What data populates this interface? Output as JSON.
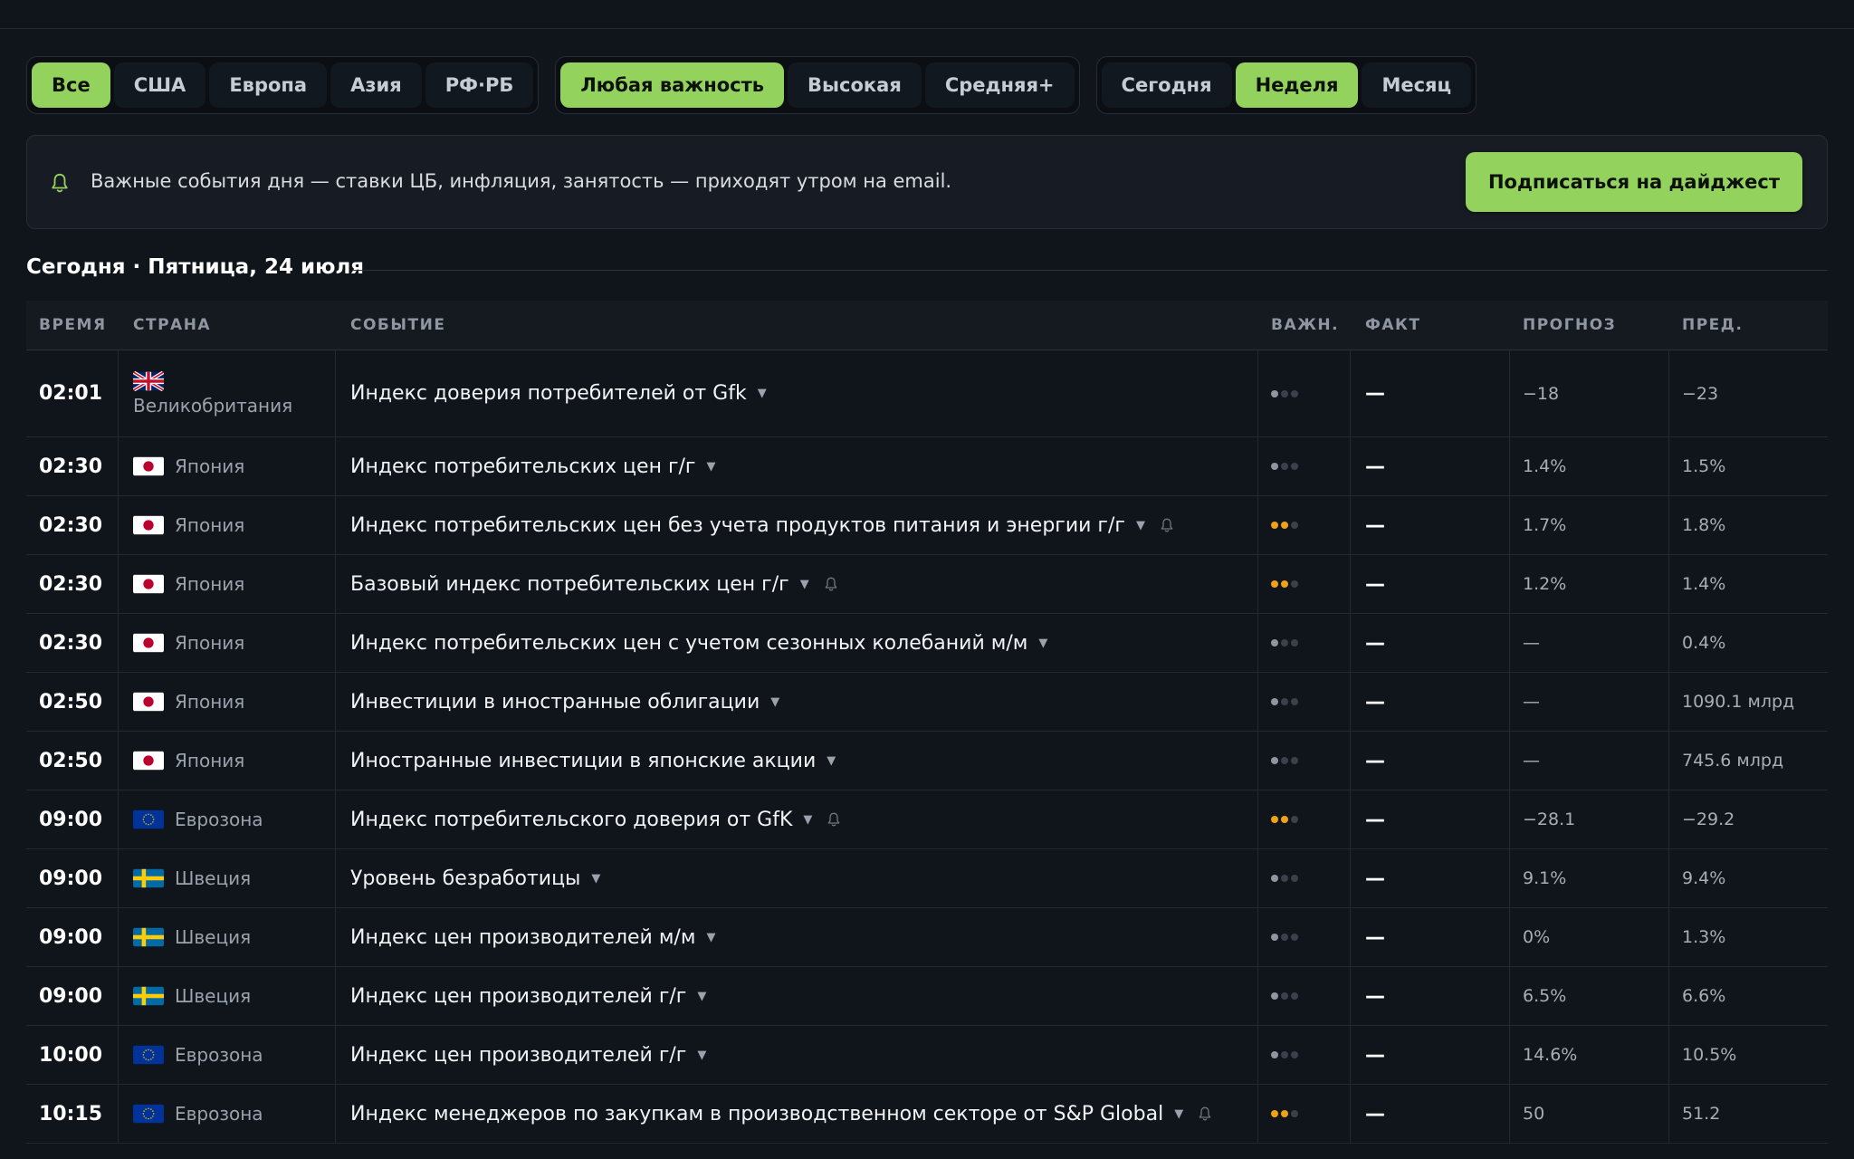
{
  "filters": {
    "region": [
      {
        "label": "Все",
        "active": true
      },
      {
        "label": "США",
        "active": false
      },
      {
        "label": "Европа",
        "active": false
      },
      {
        "label": "Азия",
        "active": false
      },
      {
        "label": "РФ·РБ",
        "active": false
      }
    ],
    "importance": [
      {
        "label": "Любая важность",
        "active": true
      },
      {
        "label": "Высокая",
        "active": false
      },
      {
        "label": "Средняя+",
        "active": false
      }
    ],
    "period": [
      {
        "label": "Сегодня",
        "active": false
      },
      {
        "label": "Неделя",
        "active": true
      },
      {
        "label": "Месяц",
        "active": false
      }
    ]
  },
  "banner": {
    "text": "Важные события дня — ставки ЦБ, инфляция, занятость — приходят утром на email.",
    "button": "Подписаться на дайджест"
  },
  "day": {
    "title": "Сегодня · Пятница, 24 июля"
  },
  "table": {
    "columns": {
      "time": "ВРЕМЯ",
      "country": "СТРАНА",
      "event": "СОБЫТИЕ",
      "importance": "ВАЖН.",
      "fact": "ФАКТ",
      "forecast": "ПРОГНОЗ",
      "previous": "ПРЕД."
    },
    "rows": [
      {
        "time": "02:01",
        "flag": "uk",
        "country": "Великобритания",
        "event": "Индекс доверия потребителей от Gfk",
        "bell": false,
        "importance": 1,
        "importance_color": "#8e96a1",
        "fact": "—",
        "forecast": "−18",
        "previous": "−23"
      },
      {
        "time": "02:30",
        "flag": "jp",
        "country": "Япония",
        "event": "Индекс потребительских цен г/г",
        "bell": false,
        "importance": 1,
        "importance_color": "#8e96a1",
        "fact": "—",
        "forecast": "1.4%",
        "previous": "1.5%"
      },
      {
        "time": "02:30",
        "flag": "jp",
        "country": "Япония",
        "event": "Индекс потребительских цен без учета продуктов питания и энергии г/г",
        "bell": true,
        "importance": 2,
        "importance_color": "#f0a11a",
        "fact": "—",
        "forecast": "1.7%",
        "previous": "1.8%"
      },
      {
        "time": "02:30",
        "flag": "jp",
        "country": "Япония",
        "event": "Базовый индекс потребительских цен г/г",
        "bell": true,
        "importance": 2,
        "importance_color": "#f0a11a",
        "fact": "—",
        "forecast": "1.2%",
        "previous": "1.4%"
      },
      {
        "time": "02:30",
        "flag": "jp",
        "country": "Япония",
        "event": "Индекс потребительских цен с учетом сезонных колебаний м/м",
        "bell": false,
        "importance": 1,
        "importance_color": "#8e96a1",
        "fact": "—",
        "forecast": "—",
        "previous": "0.4%"
      },
      {
        "time": "02:50",
        "flag": "jp",
        "country": "Япония",
        "event": "Инвестиции в иностранные облигации",
        "bell": false,
        "importance": 1,
        "importance_color": "#8e96a1",
        "fact": "—",
        "forecast": "—",
        "previous": "1090.1 млрд"
      },
      {
        "time": "02:50",
        "flag": "jp",
        "country": "Япония",
        "event": "Иностранные инвестиции в японские акции",
        "bell": false,
        "importance": 1,
        "importance_color": "#8e96a1",
        "fact": "—",
        "forecast": "—",
        "previous": "745.6 млрд"
      },
      {
        "time": "09:00",
        "flag": "eu",
        "country": "Еврозона",
        "event": "Индекс потребительского доверия от GfK",
        "bell": true,
        "importance": 2,
        "importance_color": "#f0a11a",
        "fact": "—",
        "forecast": "−28.1",
        "previous": "−29.2"
      },
      {
        "time": "09:00",
        "flag": "se",
        "country": "Швеция",
        "event": "Уровень безработицы",
        "bell": false,
        "importance": 1,
        "importance_color": "#8e96a1",
        "fact": "—",
        "forecast": "9.1%",
        "previous": "9.4%"
      },
      {
        "time": "09:00",
        "flag": "se",
        "country": "Швеция",
        "event": "Индекс цен производителей м/м",
        "bell": false,
        "importance": 1,
        "importance_color": "#8e96a1",
        "fact": "—",
        "forecast": "0%",
        "previous": "1.3%"
      },
      {
        "time": "09:00",
        "flag": "se",
        "country": "Швеция",
        "event": "Индекс цен производителей г/г",
        "bell": false,
        "importance": 1,
        "importance_color": "#8e96a1",
        "fact": "—",
        "forecast": "6.5%",
        "previous": "6.6%"
      },
      {
        "time": "10:00",
        "flag": "eu",
        "country": "Еврозона",
        "event": "Индекс цен производителей г/г",
        "bell": false,
        "importance": 1,
        "importance_color": "#8e96a1",
        "fact": "—",
        "forecast": "14.6%",
        "previous": "10.5%"
      },
      {
        "time": "10:15",
        "flag": "eu",
        "country": "Еврозона",
        "event": "Индекс менеджеров по закупкам в производственном секторе от S&P Global",
        "bell": true,
        "importance": 2,
        "importance_color": "#f0a11a",
        "fact": "—",
        "forecast": "50",
        "previous": "51.2"
      }
    ]
  }
}
